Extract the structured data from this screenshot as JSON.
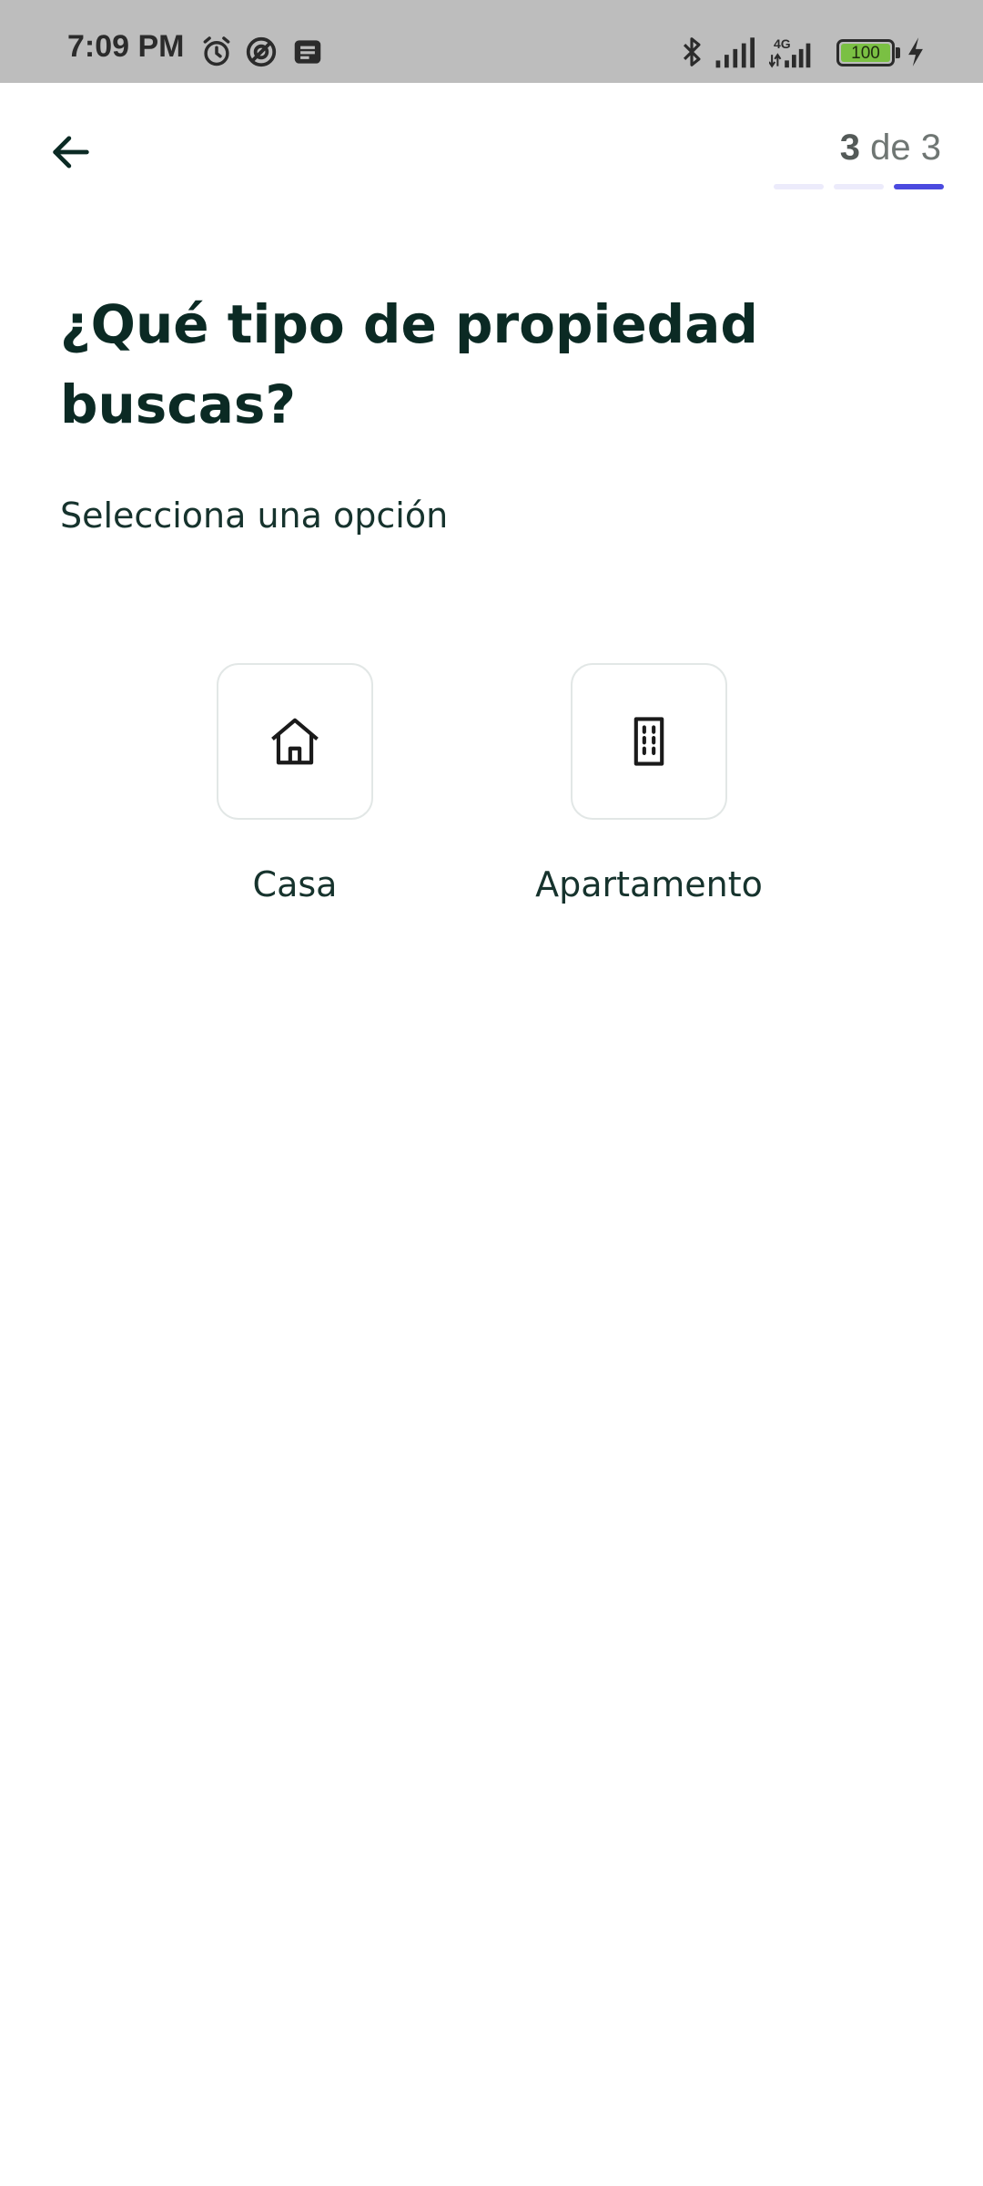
{
  "status_bar": {
    "time": "7:09 PM",
    "battery": "100",
    "network": "4G",
    "icons": [
      "alarm-icon",
      "no-disturb-icon",
      "notification-icon",
      "bluetooth-icon",
      "signal-icon",
      "signal-4g-icon",
      "battery-icon",
      "charging-icon"
    ]
  },
  "header": {
    "back_icon": "arrow-left-icon",
    "step_current": "3",
    "step_rest": " de 3",
    "progress": {
      "total": 3,
      "completed": 3,
      "active_color": "#4b4adf",
      "inactive_color": "#ecebfb"
    }
  },
  "main": {
    "title": "¿Qué tipo de propiedad buscas?",
    "subtitle": "Selecciona una opción",
    "options": [
      {
        "label": "Casa",
        "icon": "house-icon"
      },
      {
        "label": "Apartamento",
        "icon": "building-icon"
      }
    ]
  },
  "colors": {
    "heading": "#0b2a24",
    "accent": "#4b4adf",
    "card_border": "#e2e7e6"
  }
}
